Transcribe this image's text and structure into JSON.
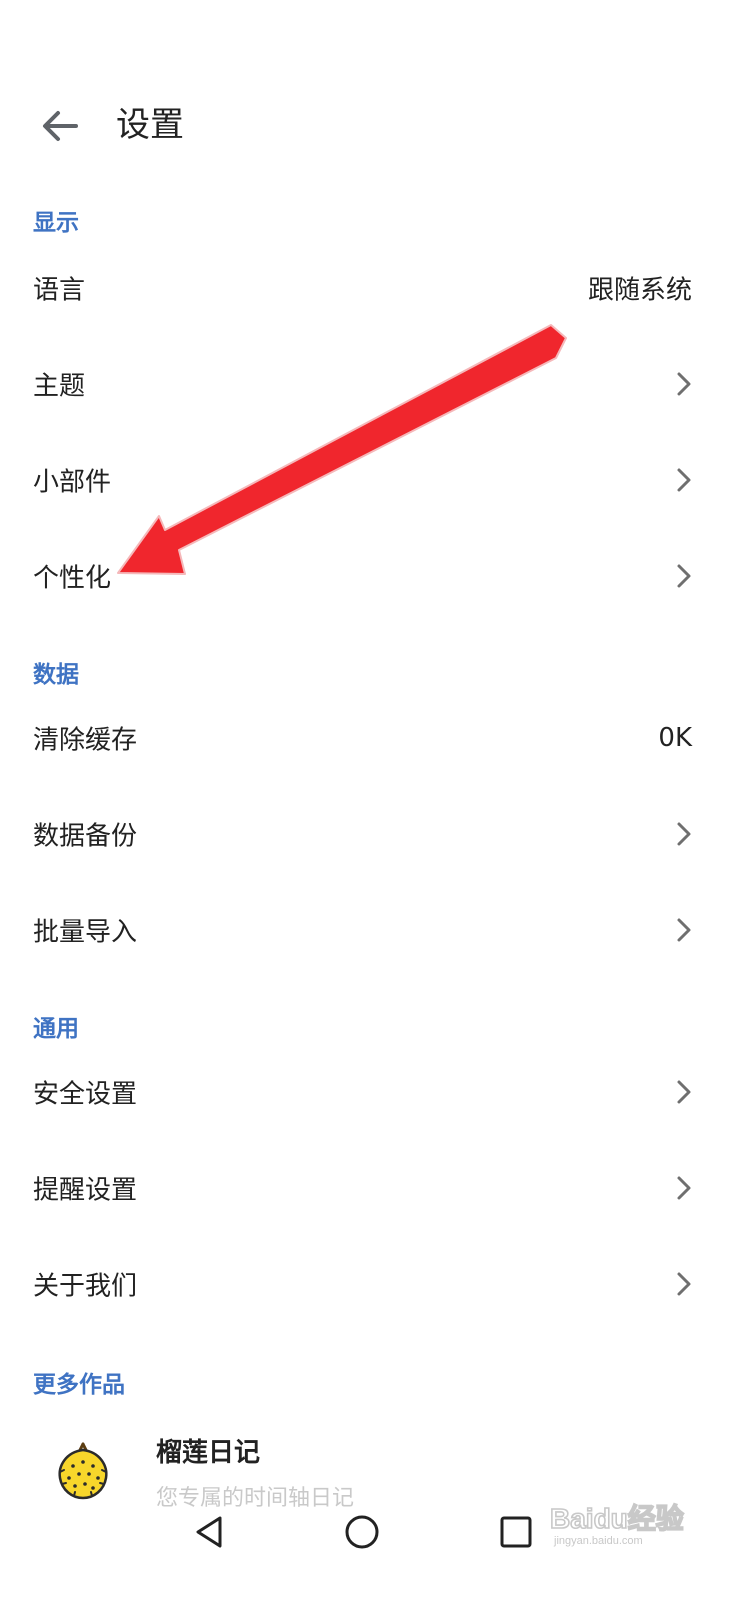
{
  "header": {
    "title": "设置",
    "back_icon": "arrow-left-icon"
  },
  "sections": {
    "display": {
      "title": "显示",
      "language_label": "语言",
      "language_value": "跟随系统",
      "theme_label": "主题",
      "widget_label": "小部件",
      "personalize_label": "个性化"
    },
    "data": {
      "title": "数据",
      "clear_cache_label": "清除缓存",
      "clear_cache_value": "0K",
      "backup_label": "数据备份",
      "import_label": "批量导入"
    },
    "general": {
      "title": "通用",
      "security_label": "安全设置",
      "reminder_label": "提醒设置",
      "about_label": "关于我们"
    },
    "more": {
      "title": "更多作品",
      "app_name": "榴莲日记",
      "app_subtitle": "您专属的时间轴日记"
    }
  },
  "navbar": {
    "back_icon": "triangle-back-icon",
    "home_icon": "circle-home-icon",
    "recents_icon": "square-recents-icon"
  },
  "watermark": {
    "text": "Baidu经验",
    "subtext": "jingyan.baidu.com"
  },
  "colors": {
    "section_header": "#3f73c3",
    "annotation_arrow": "#f0262d",
    "chevron": "#6f6f6f",
    "durian_icon": "#f7d62b"
  }
}
